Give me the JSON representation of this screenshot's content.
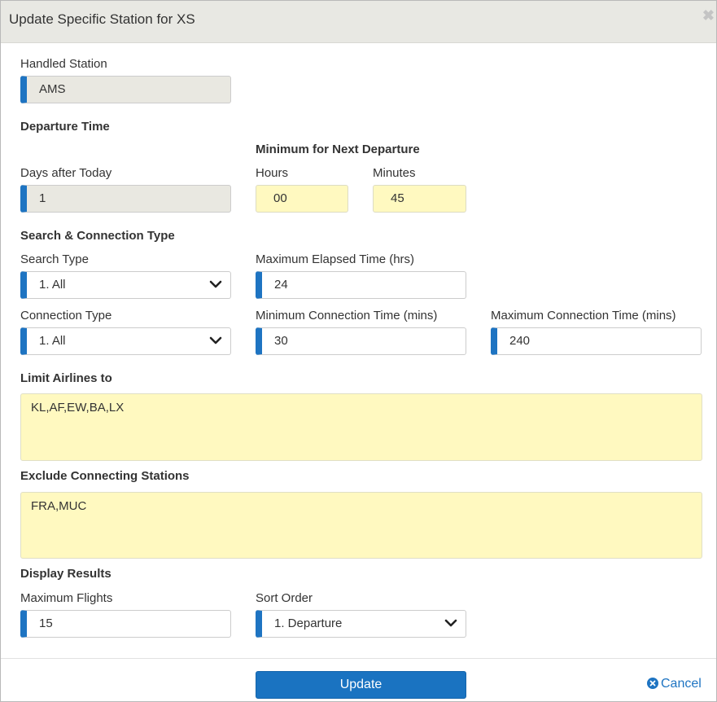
{
  "dialog": {
    "title": "Update Specific Station for XS",
    "close_icon": "close-x-icon"
  },
  "handled_station": {
    "label": "Handled Station",
    "value": "AMS"
  },
  "departure_time": {
    "heading": "Departure Time",
    "min_next_heading": "Minimum for Next Departure",
    "days_label": "Days after Today",
    "days_value": "1",
    "hours_label": "Hours",
    "hours_value": "00",
    "minutes_label": "Minutes",
    "minutes_value": "45"
  },
  "search_connection": {
    "heading": "Search & Connection Type",
    "search_type_label": "Search Type",
    "search_type_value": "1. All",
    "max_elapsed_label": "Maximum Elapsed Time (hrs)",
    "max_elapsed_value": "24",
    "connection_type_label": "Connection Type",
    "connection_type_value": "1. All",
    "min_conn_label": "Minimum Connection Time (mins)",
    "min_conn_value": "30",
    "max_conn_label": "Maximum Connection Time (mins)",
    "max_conn_value": "240"
  },
  "limit_airlines": {
    "heading": "Limit Airlines to",
    "value": "KL,AF,EW,BA,LX"
  },
  "exclude_stations": {
    "heading": "Exclude Connecting Stations",
    "value": "FRA,MUC"
  },
  "display_results": {
    "heading": "Display Results",
    "max_flights_label": "Maximum Flights",
    "max_flights_value": "15",
    "sort_order_label": "Sort Order",
    "sort_order_value": "1. Departure"
  },
  "footer": {
    "update_label": "Update",
    "cancel_label": "Cancel"
  },
  "colors": {
    "accent_blue": "#1e74c2",
    "readonly_bg": "#e9e8e1",
    "highlight_yellow": "#fff9c0",
    "header_bg": "#e8e8e3"
  }
}
